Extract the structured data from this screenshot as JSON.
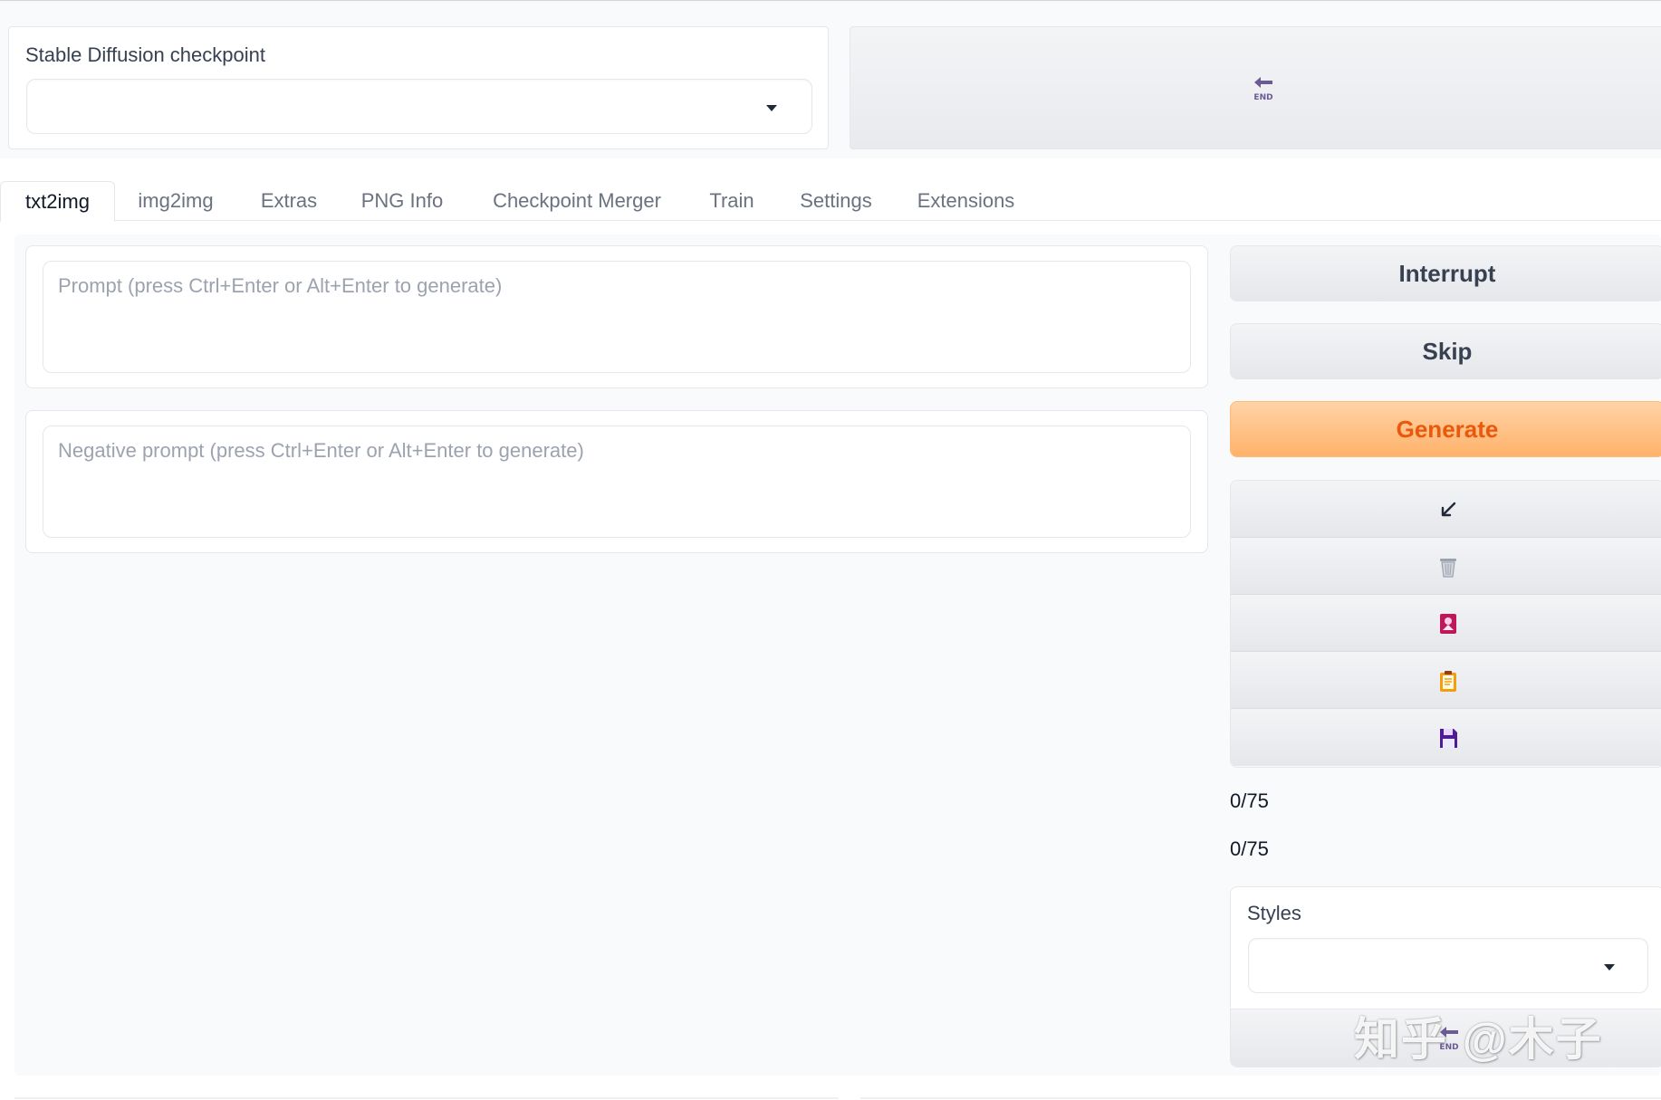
{
  "checkpoint": {
    "label": "Stable Diffusion checkpoint",
    "selected_value": "",
    "refresh_icon": "refresh-end-icon"
  },
  "tabs": [
    {
      "label": "txt2img",
      "active": true
    },
    {
      "label": "img2img",
      "active": false
    },
    {
      "label": "Extras",
      "active": false
    },
    {
      "label": "PNG Info",
      "active": false
    },
    {
      "label": "Checkpoint Merger",
      "active": false
    },
    {
      "label": "Train",
      "active": false
    },
    {
      "label": "Settings",
      "active": false
    },
    {
      "label": "Extensions",
      "active": false
    }
  ],
  "prompt": {
    "placeholder": "Prompt (press Ctrl+Enter or Alt+Enter to generate)",
    "value": ""
  },
  "negative_prompt": {
    "placeholder": "Negative prompt (press Ctrl+Enter or Alt+Enter to generate)",
    "value": ""
  },
  "actions": {
    "interrupt_label": "Interrupt",
    "skip_label": "Skip",
    "generate_label": "Generate"
  },
  "tools": [
    {
      "icon": "arrow-down-left-icon"
    },
    {
      "icon": "trash-icon"
    },
    {
      "icon": "picture-card-icon"
    },
    {
      "icon": "clipboard-icon"
    },
    {
      "icon": "floppy-disk-icon"
    }
  ],
  "token_counters": {
    "prompt": "0/75",
    "negative": "0/75"
  },
  "styles": {
    "label": "Styles",
    "selected_value": "",
    "apply_icon": "apply-style-icon"
  },
  "watermark": "知乎 @木子",
  "colors": {
    "generate_text": "#ea580c",
    "generate_bg": "#ffb26b",
    "refresh_icon": "#6b5b95"
  }
}
